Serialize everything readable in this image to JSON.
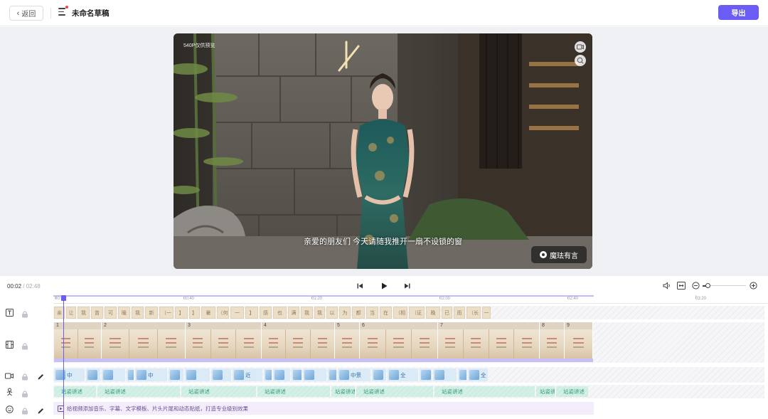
{
  "header": {
    "back_label": "返回",
    "draft_title": "未命名草稿",
    "export_label": "导出",
    "accent_color": "#6b5cf6"
  },
  "preview": {
    "quality_tag": "540P仅供预览",
    "subtitle": "亲爱的朋友们 今天请随我推开一扇不设锁的窗",
    "watermark": "魔珐有言",
    "controls": [
      "camera-icon",
      "zoom-icon"
    ]
  },
  "playback": {
    "current_time": "00:02",
    "separator": " / ",
    "total_time": "02:48"
  },
  "ruler": {
    "ticks": [
      "00:00",
      "00:40",
      "01:20",
      "02:00",
      "02:40",
      "03:20"
    ]
  },
  "tracks": {
    "text_segments": [
      "亲",
      "让",
      "我",
      "曾",
      "可",
      "暖",
      "我",
      "新",
      "（一",
      "】",
      "】",
      "暑",
      "（何",
      "一",
      "】",
      "感",
      "也",
      "满",
      "我",
      "我",
      "以",
      "为",
      "都",
      "当",
      "在",
      "（相",
      "（证",
      "晚",
      "已",
      "而",
      "（长",
      "一"
    ],
    "clip_numbers": [
      "1",
      "2",
      "3",
      "4",
      "5",
      "6",
      "7",
      "8",
      "9"
    ],
    "avatar_labels": [
      "中",
      "",
      "",
      "",
      "中",
      "",
      "",
      "",
      "近",
      "",
      "",
      "",
      "",
      "画",
      "中景",
      "",
      "全",
      "",
      "",
      "",
      "全"
    ],
    "action_labels": [
      "站姿讲述",
      "站姿讲述",
      "站姿讲述",
      "站姿讲述",
      "站姿讲述",
      "站姿讲述",
      "站姿讲述",
      "站姿讲述",
      "站姿讲述"
    ],
    "music_hint": "给视频添加音乐、字幕、文字模板、片头片尾和动态贴纸，打造专业级别效果"
  }
}
